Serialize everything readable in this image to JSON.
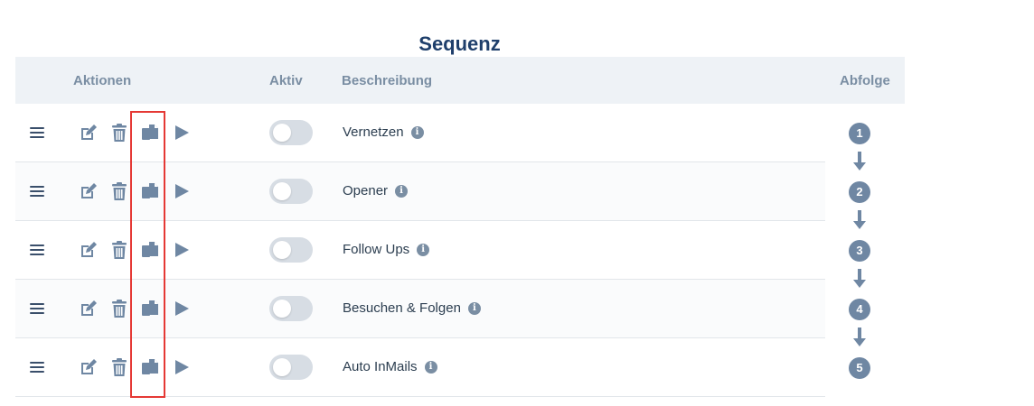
{
  "title": "Sequenz",
  "header": {
    "actions": "Aktionen",
    "active": "Aktiv",
    "description": "Beschreibung",
    "sequence": "Abfolge"
  },
  "rows": [
    {
      "description": "Vernetzen",
      "active": false,
      "step": "1"
    },
    {
      "description": "Opener",
      "active": false,
      "step": "2"
    },
    {
      "description": "Follow Ups",
      "active": false,
      "step": "3"
    },
    {
      "description": "Besuchen & Folgen",
      "active": false,
      "step": "4"
    },
    {
      "description": "Auto InMails",
      "active": false,
      "step": "5"
    }
  ],
  "info_glyph": "i",
  "icons": {
    "drag": "drag-handle-icon",
    "edit": "edit-icon",
    "delete": "trash-icon",
    "duplicate": "copy-icon",
    "run": "play-icon",
    "info": "info-icon"
  },
  "colors": {
    "title": "#1f3f6b",
    "header_bg": "#eef2f6",
    "icon": "#6f87a3",
    "highlight": "#e53935"
  }
}
